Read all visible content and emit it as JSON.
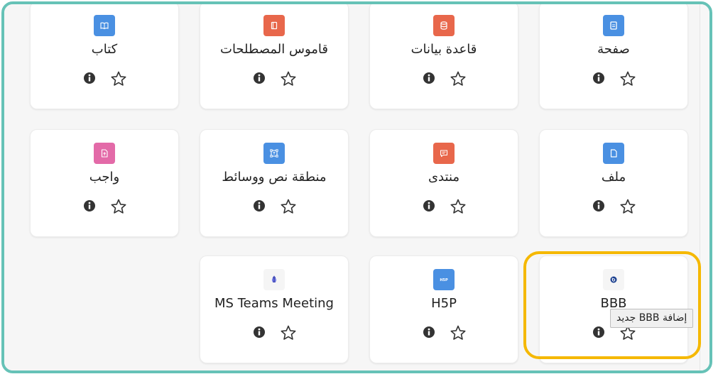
{
  "activities": [
    {
      "name": "صفحة",
      "icon": "page-icon",
      "color": "#4a90e2"
    },
    {
      "name": "قاعدة بيانات",
      "icon": "database-icon",
      "color": "#e8674b"
    },
    {
      "name": "قاموس المصطلحات",
      "icon": "glossary-icon",
      "color": "#e8674b"
    },
    {
      "name": "كتاب",
      "icon": "book-icon",
      "color": "#4a90e2"
    },
    {
      "name": "ملف",
      "icon": "file-icon",
      "color": "#4a90e2"
    },
    {
      "name": "منتدى",
      "icon": "forum-icon",
      "color": "#e8674b"
    },
    {
      "name": "منطقة نص ووسائط",
      "icon": "text-media-icon",
      "color": "#4a90e2"
    },
    {
      "name": "واجب",
      "icon": "assignment-icon",
      "color": "#e36aa8"
    },
    {
      "name": "BBB",
      "icon": "bigbluebutton-icon",
      "color": "#f5f5f5"
    },
    {
      "name": "H5P",
      "icon": "h5p-icon",
      "color": "#4a90e2"
    },
    {
      "name": "MS Teams Meeting",
      "icon": "ms-teams-icon",
      "color": "#f5f5f5"
    }
  ],
  "tooltip": "إضافة BBB جديد",
  "colors": {
    "frame_border": "#66c2b7",
    "highlight_border": "#f5b800",
    "card_bg": "#ffffff",
    "icon_blue": "#4a90e2",
    "icon_orange": "#e8674b",
    "icon_pink": "#e36aa8"
  }
}
